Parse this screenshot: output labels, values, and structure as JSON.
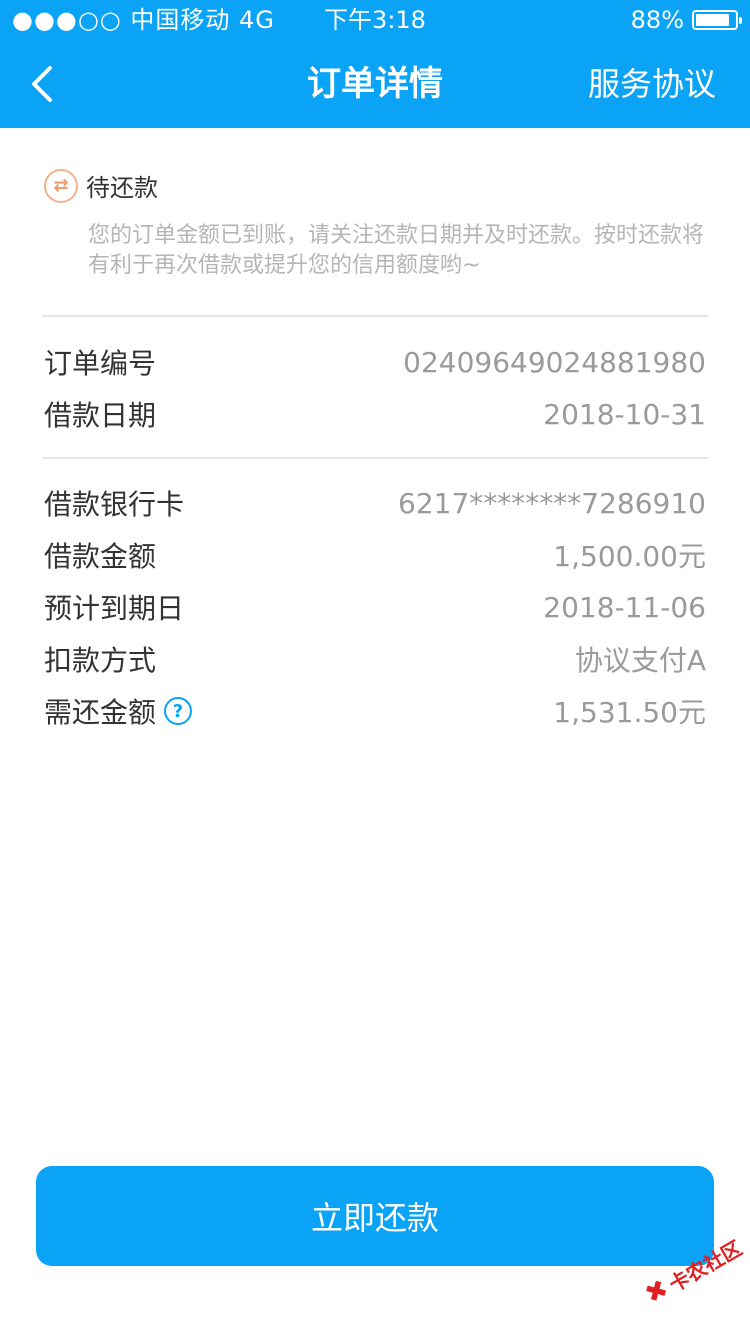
{
  "status_bar": {
    "carrier": "●●●○○ 中国移动  4G",
    "time": "下午3:18",
    "battery_percent": "88%",
    "battery_level": 0.88
  },
  "navbar": {
    "title": "订单详情",
    "right_link": "服务协议",
    "back_icon": "chevron-left-icon"
  },
  "order_status": {
    "label": "待还款",
    "description": "您的订单金额已到账，请关注还款日期并及时还款。按时还款将有利于再次借款或提升您的信用额度哟~",
    "icon": "exchange-icon",
    "icon_glyph": "⇄"
  },
  "order_info": [
    {
      "label": "订单编号",
      "value": "02409649024881980"
    },
    {
      "label": "借款日期",
      "value": "2018-10-31"
    }
  ],
  "loan_info": [
    {
      "label": "借款银行卡",
      "value": "6217********7286910"
    },
    {
      "label": "借款金额",
      "value": "1,500.00元"
    },
    {
      "label": "预计到期日",
      "value": "2018-11-06"
    },
    {
      "label": "扣款方式",
      "value": "协议支付A"
    },
    {
      "label": "需还金额",
      "value": "1,531.50元"
    }
  ],
  "help_glyph": "?",
  "primary_button": "立即还款",
  "watermark": "卡农社区",
  "colors": {
    "accent": "#0aa3f5",
    "pending": "#f39a6b"
  }
}
